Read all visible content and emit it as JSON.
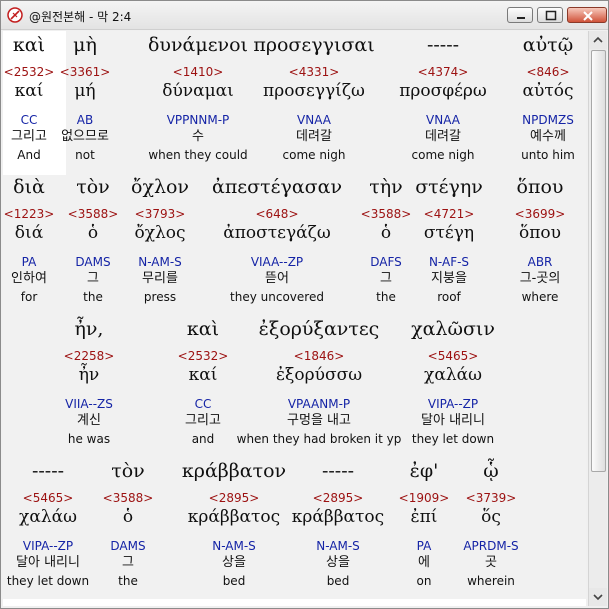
{
  "window": {
    "title": "@원전본해 - 막 2:4",
    "icon": "app-feather-icon",
    "controls": [
      "minimize",
      "maximize",
      "close"
    ]
  },
  "rows": [
    {
      "cells": [
        {
          "greek": "καὶ",
          "strongs": "<2532>",
          "lemma": "καί",
          "parse": "CC",
          "korean": "그리고",
          "english": "And"
        },
        {
          "greek": "μὴ",
          "strongs": "<3361>",
          "lemma": "μή",
          "parse": "AB",
          "korean": "없으므로",
          "english": "not"
        },
        {
          "greek": "δυνάμενοι",
          "strongs": "<1410>",
          "lemma": "δύναμαι",
          "parse": "VPPNNM-P",
          "korean": "수",
          "english": "when they could"
        },
        {
          "greek": "προσεγγισαι",
          "strongs": "<4331>",
          "lemma": "προσεγγίζω",
          "parse": "VNAA",
          "korean": "데려갈",
          "english": "come nigh"
        },
        {
          "greek": "-----",
          "strongs": "<4374>",
          "lemma": "προσφέρω",
          "parse": "VNAA",
          "korean": "데려갈",
          "english": "come nigh"
        },
        {
          "greek": "αὐτῷ",
          "strongs": "<846>",
          "lemma": "αὐτός",
          "parse": "NPDMZS",
          "korean": "예수께",
          "english": "unto him"
        }
      ]
    },
    {
      "cells": [
        {
          "greek": "διὰ",
          "strongs": "<1223>",
          "lemma": "διά",
          "parse": "PA",
          "korean": "인하여",
          "english": "for"
        },
        {
          "greek": "τὸν",
          "strongs": "<3588>",
          "lemma": "ὁ",
          "parse": "DAMS",
          "korean": "그",
          "english": "the"
        },
        {
          "greek": "ὄχλον",
          "strongs": "<3793>",
          "lemma": "ὄχλος",
          "parse": "N-AM-S",
          "korean": "무리를",
          "english": "press"
        },
        {
          "greek": "ἀπεστέγασαν",
          "strongs": "<648>",
          "lemma": "ἀποστεγάζω",
          "parse": "VIAA--ZP",
          "korean": "뜯어",
          "english": "they uncovered"
        },
        {
          "greek": "τὴν",
          "strongs": "<3588>",
          "lemma": "ὁ",
          "parse": "DAFS",
          "korean": "그",
          "english": "the"
        },
        {
          "greek": "στέγην",
          "strongs": "<4721>",
          "lemma": "στέγη",
          "parse": "N-AF-S",
          "korean": "지붕을",
          "english": "roof"
        },
        {
          "greek": "ὅπου",
          "strongs": "<3699>",
          "lemma": "ὅπου",
          "parse": "ABR",
          "korean": "그-곳의",
          "english": "where"
        }
      ]
    },
    {
      "cells": [
        {
          "greek": "ἦν,",
          "strongs": "<2258>",
          "lemma": "ἦν",
          "parse": "VIIA--ZS",
          "korean": "계신",
          "english": "he was"
        },
        {
          "greek": "καὶ",
          "strongs": "<2532>",
          "lemma": "καί",
          "parse": "CC",
          "korean": "그리고",
          "english": "and"
        },
        {
          "greek": "ἐξορύξαντες",
          "strongs": "<1846>",
          "lemma": "ἐξορύσσω",
          "parse": "VPAANM-P",
          "korean": "구멍을 내고",
          "english": "when they had broken it yp"
        },
        {
          "greek": "χαλῶσιν",
          "strongs": "<5465>",
          "lemma": "χαλάω",
          "parse": "VIPA--ZP",
          "korean": "달아 내리니",
          "english": "they let down"
        }
      ]
    },
    {
      "cells": [
        {
          "greek": "-----",
          "strongs": "<5465>",
          "lemma": "χαλάω",
          "parse": "VIPA--ZP",
          "korean": "달아 내리니",
          "english": "they let down"
        },
        {
          "greek": "τὸν",
          "strongs": "<3588>",
          "lemma": "ὁ",
          "parse": "DAMS",
          "korean": "그",
          "english": "the"
        },
        {
          "greek": "κράββατον",
          "strongs": "<2895>",
          "lemma": "κράββατος",
          "parse": "N-AM-S",
          "korean": "상을",
          "english": "bed"
        },
        {
          "greek": "-----",
          "strongs": "<2895>",
          "lemma": "κράββατος",
          "parse": "N-AM-S",
          "korean": "상을",
          "english": "bed"
        },
        {
          "greek": "ἐφ'",
          "strongs": "<1909>",
          "lemma": "ἐπί",
          "parse": "PA",
          "korean": "에",
          "english": "on"
        },
        {
          "greek": "ᾧ",
          "strongs": "<3739>",
          "lemma": "ὅς",
          "parse": "APRDM-S",
          "korean": "곳",
          "english": "wherein"
        }
      ]
    }
  ]
}
